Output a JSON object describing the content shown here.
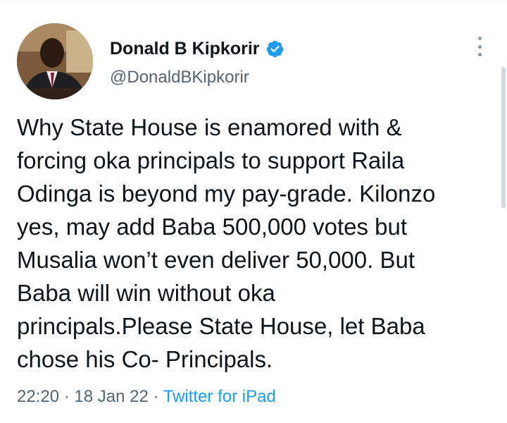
{
  "author": {
    "display_name": "Donald B Kipkorir",
    "handle": "@DonaldBKipkorir",
    "verified": true
  },
  "tweet": {
    "lines": [
      "Why State House is enamored with &",
      "forcing oka principals to support Raila",
      "Odinga is beyond my pay-grade. Kilonzo",
      "yes, may add Baba 500,000 votes but",
      "Musalia won’t even deliver 50,000. But",
      "Baba will win without oka",
      "principals.Please State House, let Baba",
      "chose his Co- Principals."
    ],
    "time": "22:20",
    "date": "18 Jan 22",
    "source": "Twitter for iPad",
    "separator": "·"
  },
  "icons": {
    "verified": "verified-badge-icon",
    "more": "more-vertical-icon"
  },
  "colors": {
    "verified": "#1d9bf0",
    "link": "#1d9bf0",
    "secondary_text": "#536471",
    "primary_text": "#0f1419"
  }
}
